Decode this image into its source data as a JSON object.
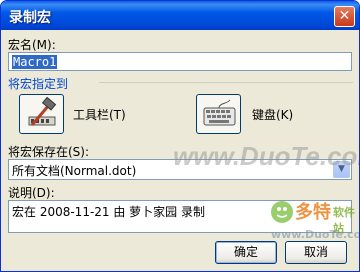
{
  "window": {
    "title": "录制宏",
    "close_glyph": "✕"
  },
  "macro_name": {
    "label": "宏名(M):",
    "value": "Macro1"
  },
  "assign_group": {
    "label": "将宏指定到",
    "toolbar_label": "工具栏(T)",
    "keyboard_label": "键盘(K)"
  },
  "store_in": {
    "label": "将宏保存在(S):",
    "value": "所有文档(Normal.dot)"
  },
  "description": {
    "label": "说明(D):",
    "value": "宏在 2008-11-21 由 萝卜家园 录制"
  },
  "buttons": {
    "ok": "确定",
    "cancel": "取消"
  },
  "watermark": {
    "site": "www.DuoTe.com",
    "logo_text": "多特",
    "logo_sub": "软件站",
    "logo_site": "www.DuoTe.com"
  },
  "colors": {
    "title_bar": "#0058e6",
    "dialog_bg": "#ece9d8",
    "group_label": "#0046d5",
    "selection": "#316ac5"
  }
}
